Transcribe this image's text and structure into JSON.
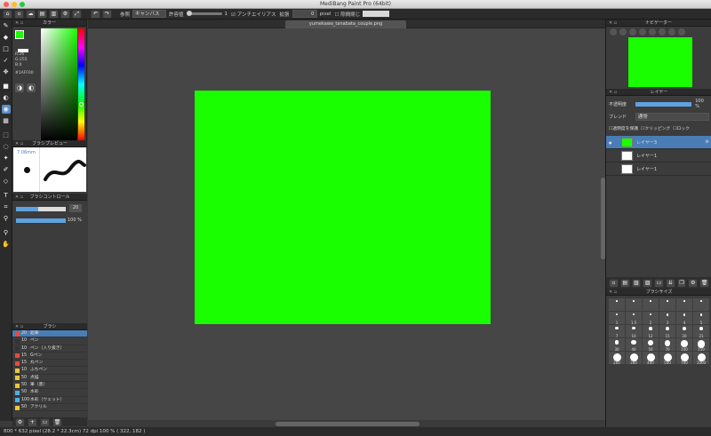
{
  "window": {
    "title": "MediBang Paint Pro (64bit)"
  },
  "toolbar": {
    "ref_label": "参照",
    "ref_value": "キャンバス",
    "tolerance_label": "許容値",
    "tolerance_value": "1",
    "antialias_label": "アンチエイリアス",
    "expand_label": "拡張",
    "expand_value": "0",
    "expand_unit": "pixel",
    "gap_close_label": "隙間閉じ"
  },
  "tab": {
    "filename": "yumekawa_tanabata_couple.png"
  },
  "color": {
    "title": "カラー",
    "r": "R:26",
    "g": "G:255",
    "b": "B:0",
    "hex": "#1AFF00",
    "fg": "#1aff00"
  },
  "brushpreview": {
    "title": "ブラシプレビュー",
    "size": "7.06mm"
  },
  "brushcontrol": {
    "title": "ブラシコントロール",
    "size_value": "20",
    "opacity_value": "100 %",
    "size_fraction": 0.45,
    "opacity_fraction": 1.0
  },
  "brushlist": {
    "title": "ブラシ",
    "items": [
      {
        "size": "20",
        "name": "鉛筆",
        "color": "#e84a3a",
        "sel": true
      },
      {
        "size": "10",
        "name": "ペン",
        "color": "#333333"
      },
      {
        "size": "10",
        "name": "ペン（入り抜き）",
        "color": "#333333"
      },
      {
        "size": "15",
        "name": "Gペン",
        "color": "#e84a3a"
      },
      {
        "size": "15",
        "name": "丸ペン",
        "color": "#e84a3a"
      },
      {
        "size": "10",
        "name": "ふちペン",
        "color": "#e8c73a"
      },
      {
        "size": "50",
        "name": "点描",
        "color": "#e8c73a"
      },
      {
        "size": "50",
        "name": "筆（墨）",
        "color": "#e8c73a"
      },
      {
        "size": "50",
        "name": "水彩",
        "color": "#4ab0e8"
      },
      {
        "size": "100",
        "name": "水彩（ウェット）",
        "color": "#4ab0e8"
      },
      {
        "size": "50",
        "name": "アクリル",
        "color": "#e8c73a"
      }
    ]
  },
  "navigator": {
    "title": "ナビゲーター"
  },
  "layer": {
    "title": "レイヤー",
    "opacity_label": "不透明度",
    "opacity_value": "100 %",
    "opacity_fraction": 1.0,
    "blend_label": "ブレンド",
    "blend_value": "通常",
    "protect_label": "透明度を保護",
    "clipping_label": "クリッピング",
    "lock_label": "ロック",
    "layers": [
      {
        "name": "レイヤー3",
        "sel": true,
        "thumb": "#1aff00"
      },
      {
        "name": "レイヤー1",
        "sel": false,
        "thumb": "#ffffff"
      },
      {
        "name": "レイヤー1",
        "sel": false,
        "thumb": "#ffffff"
      }
    ]
  },
  "brushsize": {
    "title": "ブラシサイズ",
    "sizes": [
      "",
      "",
      "",
      "",
      "",
      "",
      " 1",
      "1.5",
      "2",
      "3",
      "4",
      "5",
      "7",
      "10",
      "12",
      "15",
      "20",
      "21",
      "30",
      "40",
      "50",
      "70",
      "100",
      "150",
      "200",
      "300",
      "400",
      "500",
      "700",
      "1000"
    ]
  },
  "status": {
    "text": "800 * 632 pixel   (28.2 * 22.3cm)   72 dpi   100 %   ( 322, 182 )"
  }
}
